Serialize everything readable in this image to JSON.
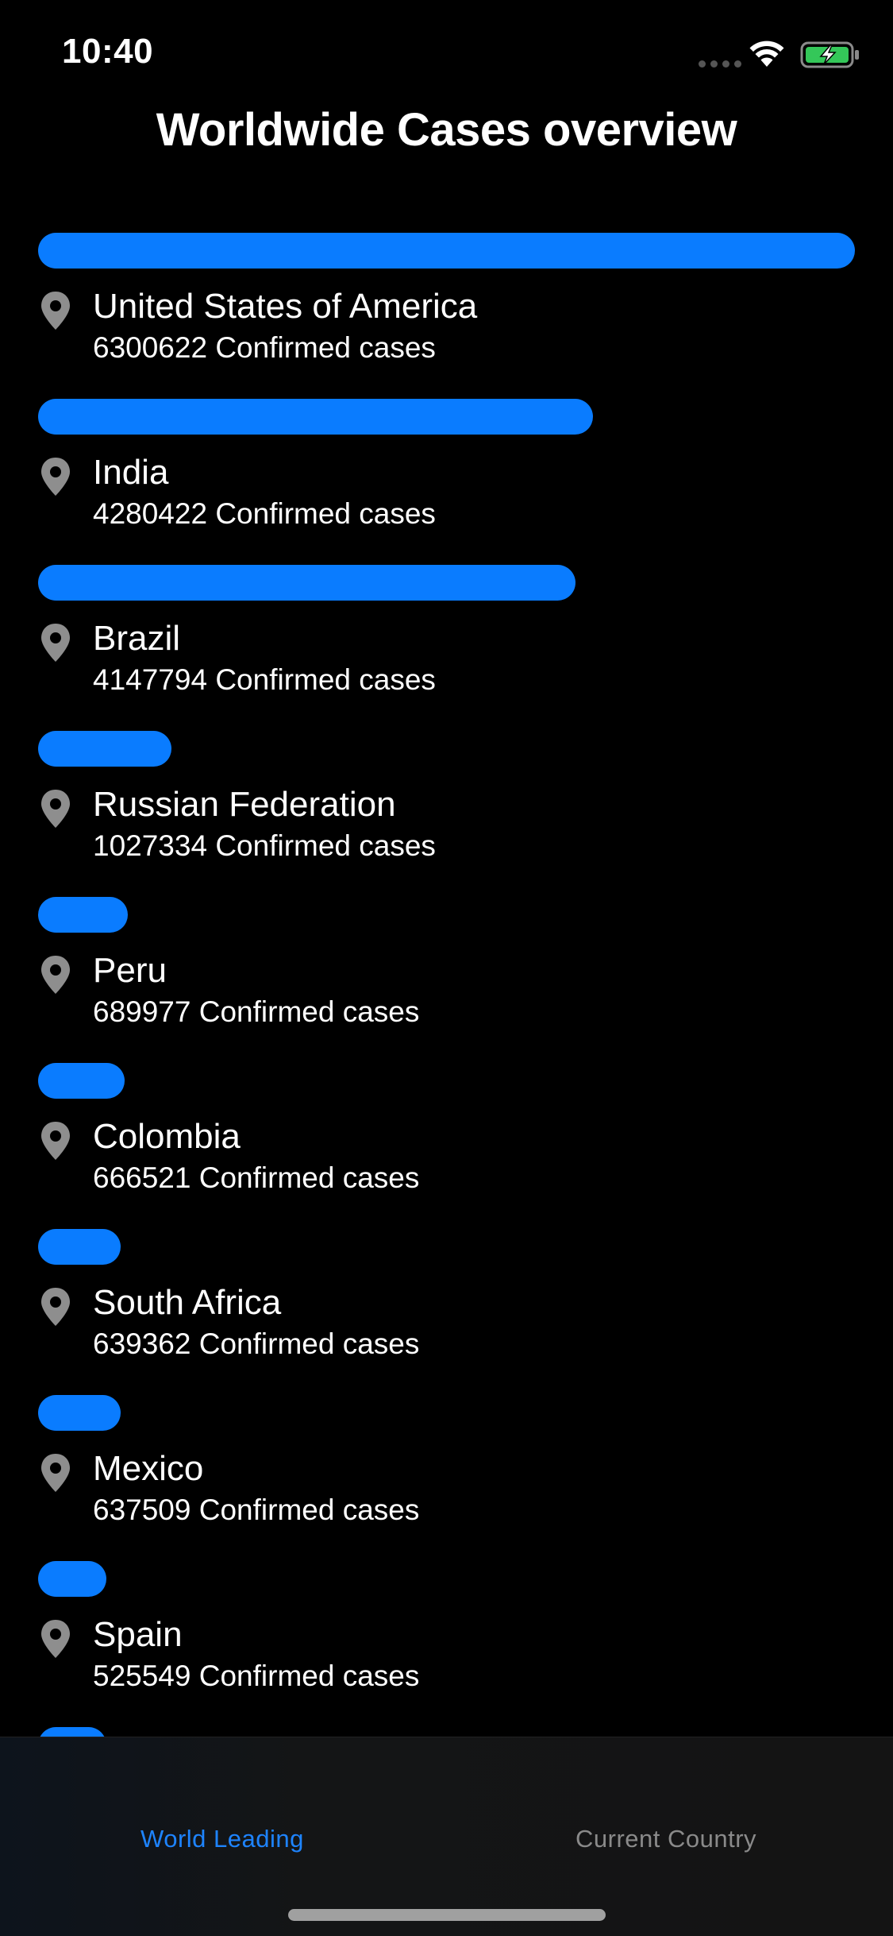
{
  "status_bar": {
    "time": "10:40"
  },
  "header": {
    "title": "Worldwide Cases overview"
  },
  "colors": {
    "accent": "#0a7cff",
    "tab_active": "#1e84ff",
    "tab_inactive": "#8a8a8a",
    "background": "#000000"
  },
  "max_cases": 6300622,
  "countries": [
    {
      "name": "United States of America",
      "cases": 6300622,
      "cases_label": "6300622 Confirmed cases"
    },
    {
      "name": "India",
      "cases": 4280422,
      "cases_label": "4280422 Confirmed cases"
    },
    {
      "name": "Brazil",
      "cases": 4147794,
      "cases_label": "4147794 Confirmed cases"
    },
    {
      "name": "Russian Federation",
      "cases": 1027334,
      "cases_label": "1027334 Confirmed cases"
    },
    {
      "name": "Peru",
      "cases": 689977,
      "cases_label": "689977 Confirmed cases"
    },
    {
      "name": "Colombia",
      "cases": 666521,
      "cases_label": "666521 Confirmed cases"
    },
    {
      "name": "South Africa",
      "cases": 639362,
      "cases_label": "639362 Confirmed cases"
    },
    {
      "name": "Mexico",
      "cases": 637509,
      "cases_label": "637509 Confirmed cases"
    },
    {
      "name": "Spain",
      "cases": 525549,
      "cases_label": "525549 Confirmed cases"
    },
    {
      "name": "",
      "cases": 500000,
      "cases_label": ""
    }
  ],
  "tabs": [
    {
      "label": "World Leading",
      "active": true
    },
    {
      "label": "Current Country",
      "active": false
    }
  ],
  "icons": {
    "location": "location-pin-icon",
    "wifi": "wifi-icon",
    "battery": "battery-charging-icon",
    "signal": "cellular-signal-icon"
  }
}
